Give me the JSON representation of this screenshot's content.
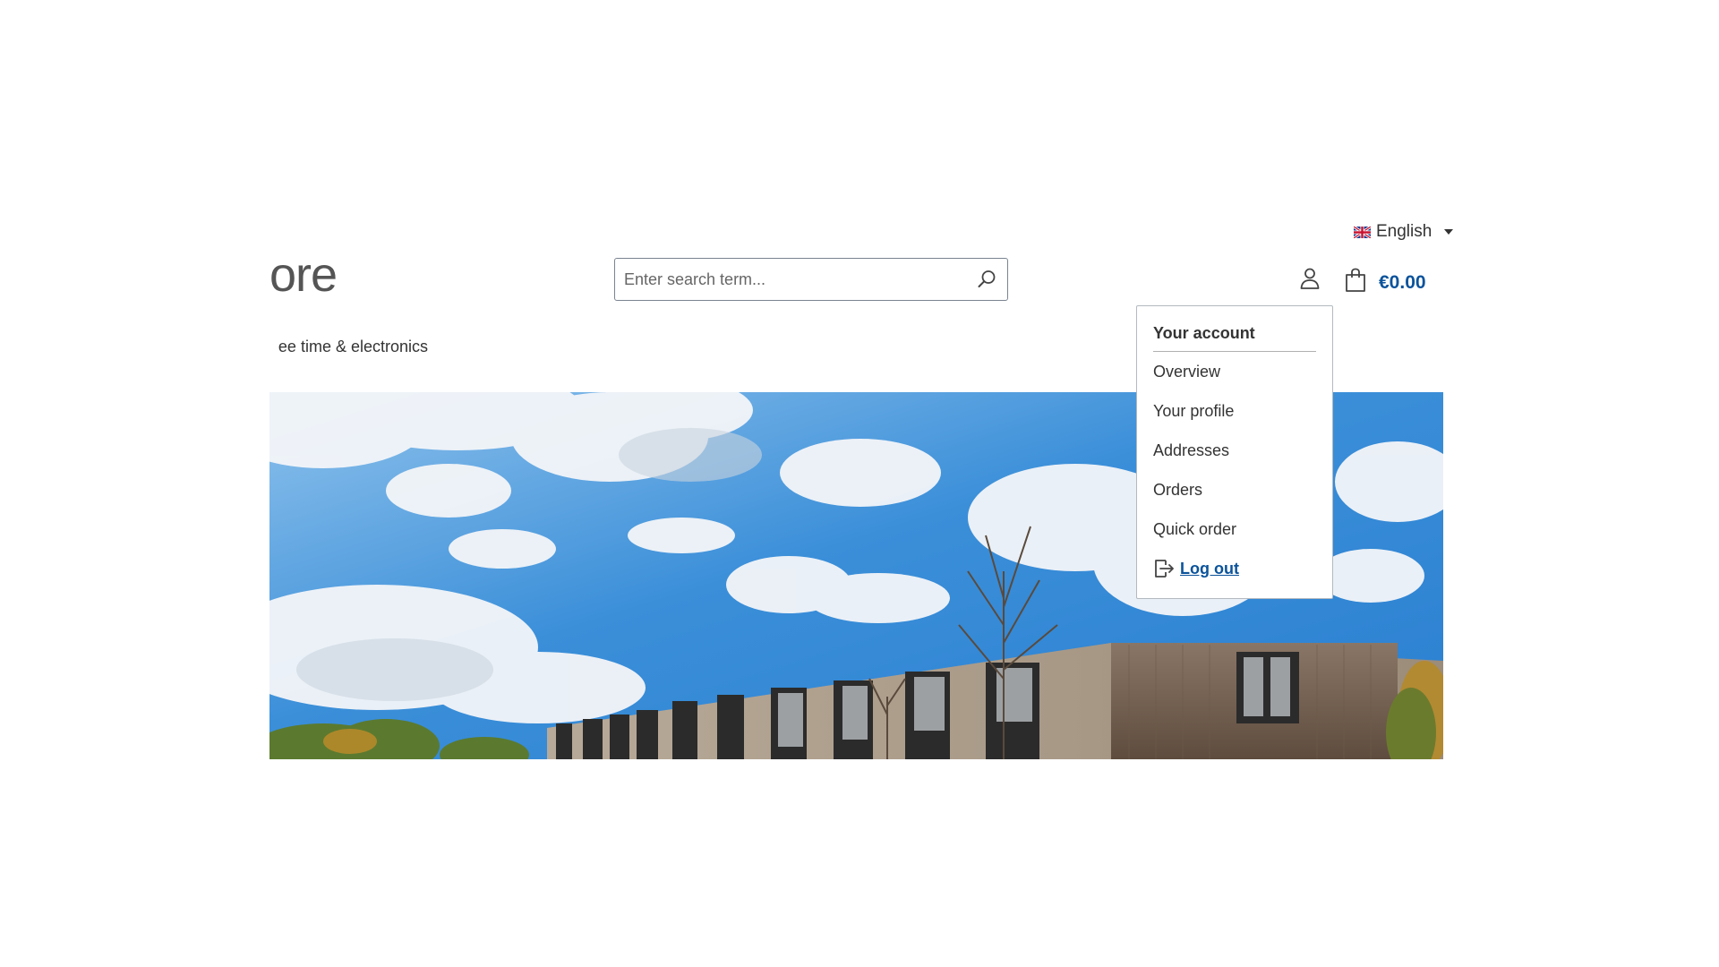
{
  "header": {
    "language": {
      "label": "English",
      "flag_icon": "uk-flag-icon"
    },
    "logo_partial_text": "ore",
    "search": {
      "placeholder": "Enter search term...",
      "value": ""
    },
    "cart": {
      "amount": "€0.00",
      "accent_color": "#0b539b"
    }
  },
  "nav": {
    "visible_category_text": "ee time & electronics"
  },
  "account_menu": {
    "title": "Your account",
    "items": [
      "Overview",
      "Your profile",
      "Addresses",
      "Orders",
      "Quick order"
    ],
    "logout_label": "Log out"
  }
}
